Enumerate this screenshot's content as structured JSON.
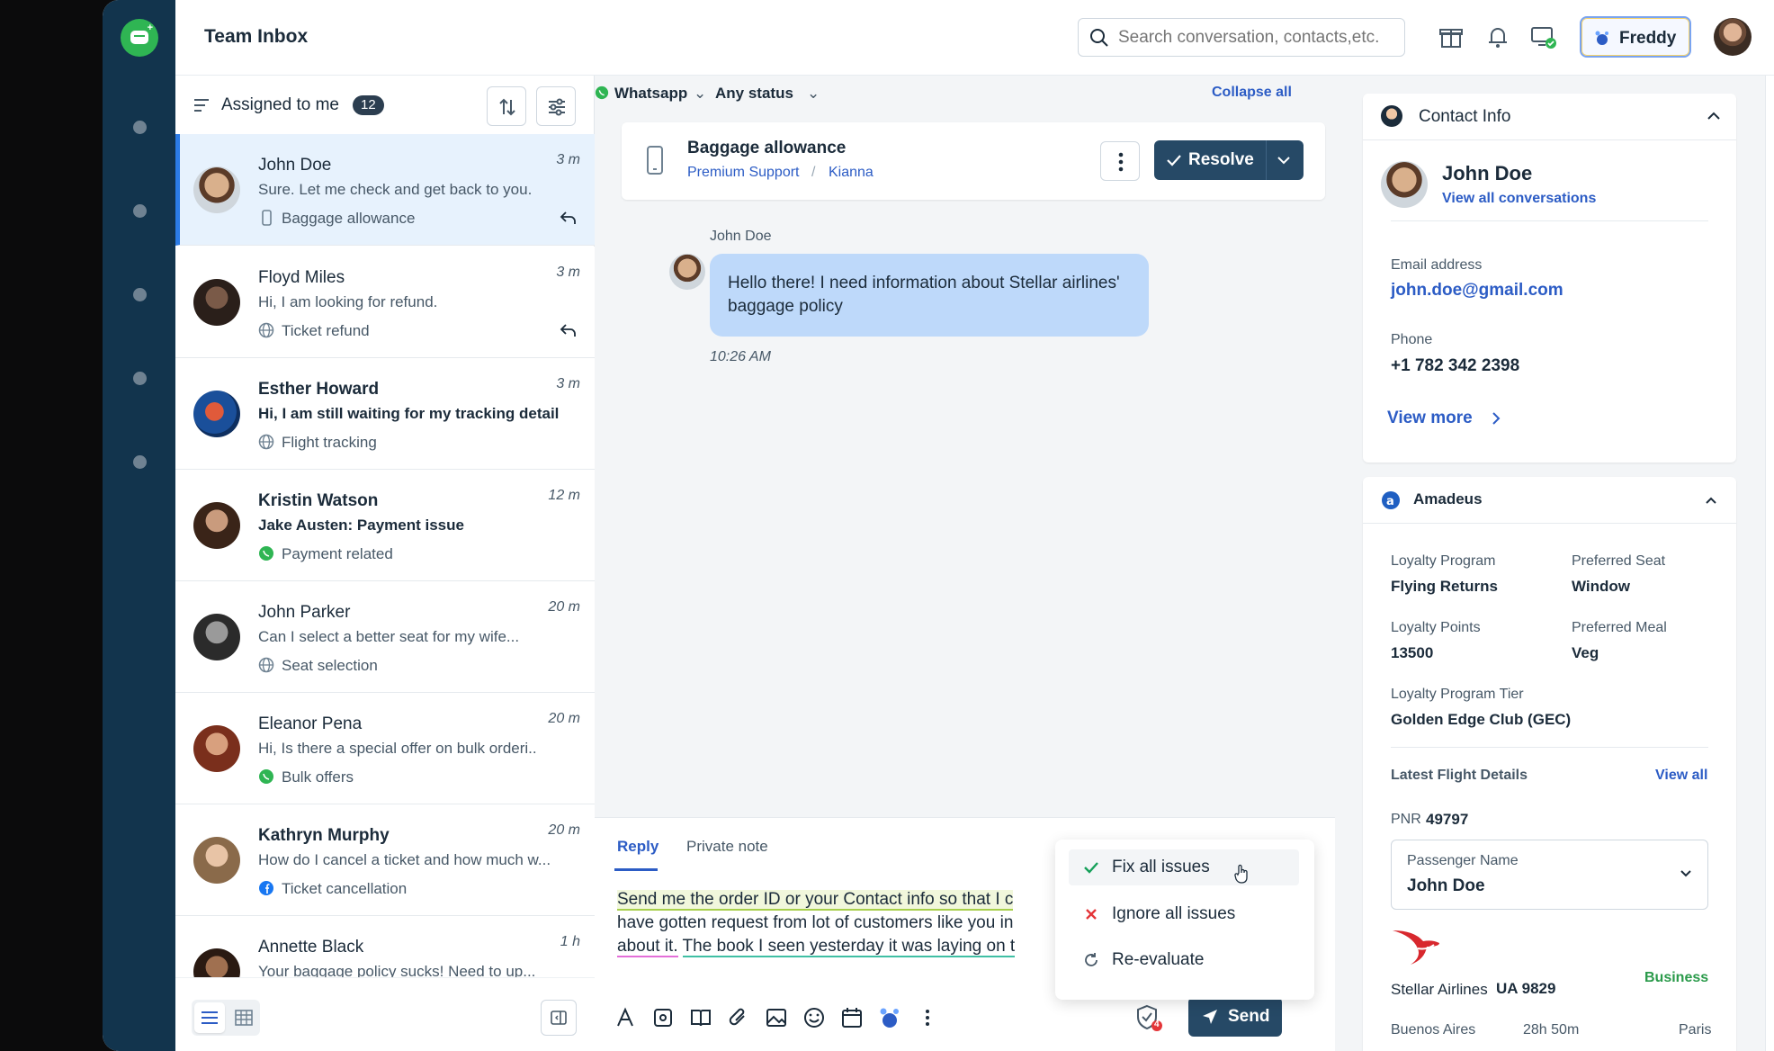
{
  "app": {
    "title": "Team Inbox"
  },
  "search": {
    "placeholder": "Search conversation, contacts,etc."
  },
  "header": {
    "freddy_label": "Freddy"
  },
  "list": {
    "filter_label": "Assigned to me",
    "count": "12",
    "items": [
      {
        "name": "John Doe",
        "time": "3 m",
        "preview": "Sure. Let me check and get back to you.",
        "tag": "Baggage allowance",
        "channel": "phone"
      },
      {
        "name": "Floyd Miles",
        "time": "3 m",
        "preview": "Hi, I am looking for refund.",
        "tag": "Ticket refund",
        "channel": "web"
      },
      {
        "name": "Esther Howard",
        "time": "3 m",
        "preview": "Hi, I am still waiting for my tracking details",
        "tag": "Flight tracking",
        "channel": "web"
      },
      {
        "name": "Kristin Watson",
        "time": "12 m",
        "preview": "Jake Austen: Payment issue",
        "tag": "Payment related",
        "channel": "whatsapp"
      },
      {
        "name": "John Parker",
        "time": "20 m",
        "preview": "Can I select a better seat for my wife...",
        "tag": "Seat selection",
        "channel": "web"
      },
      {
        "name": "Eleanor Pena",
        "time": "20 m",
        "preview": "Hi, Is there a special offer on bulk orderi..",
        "tag": "Bulk offers",
        "channel": "whatsapp"
      },
      {
        "name": "Kathryn Murphy",
        "time": "20 m",
        "preview": "How do I cancel a ticket and how much w...",
        "tag": "Ticket cancellation",
        "channel": "facebook"
      },
      {
        "name": "Annette Black",
        "time": "1 h",
        "preview": "Your baggage policy sucks! Need to up...",
        "tag": "",
        "channel": ""
      }
    ]
  },
  "conversation": {
    "channel_filter": "Whatsapp",
    "status_filter": "Any status",
    "collapse_label": "Collapse all",
    "title": "Baggage allowance",
    "group": "Premium Support",
    "separator": "/",
    "agent": "Kianna",
    "resolve_label": "Resolve",
    "message": {
      "sender": "John Doe",
      "text": "Hello there! I need information about Stellar airlines' baggage policy",
      "time": "10:26 AM"
    }
  },
  "composer": {
    "tab_reply": "Reply",
    "tab_note": "Private note",
    "line1": "Send me the order ID or your Contact info so that I c",
    "line2": "have gotten request from lot of customers like you in",
    "line3a": "about it.",
    "line3b": "The book I seen yesterday it was laying on t",
    "send_label": "Send",
    "issue_count": "4"
  },
  "popup": {
    "fix": "Fix all issues",
    "ignore": "Ignore all issues",
    "reevaluate": "Re-evaluate"
  },
  "contact": {
    "header": "Contact Info",
    "name": "John Doe",
    "view_all": "View all conversations",
    "email_label": "Email address",
    "email": "john.doe@gmail.com",
    "phone_label": "Phone",
    "phone": "+1 782 342 2398",
    "view_more": "View more"
  },
  "amadeus": {
    "header": "Amadeus",
    "loyalty_program_label": "Loyalty Program",
    "loyalty_program": "Flying Returns",
    "preferred_seat_label": "Preferred Seat",
    "preferred_seat": "Window",
    "loyalty_points_label": "Loyalty Points",
    "loyalty_points": "13500",
    "preferred_meal_label": "Preferred Meal",
    "preferred_meal": "Veg",
    "tier_label": "Loyalty Program Tier",
    "tier": "Golden Edge Club (GEC)",
    "latest_label": "Latest Flight Details",
    "view_all": "View all",
    "pnr_label": "PNR",
    "pnr": "49797",
    "passenger_label": "Passenger Name",
    "passenger": "John Doe",
    "airline": "Stellar Airlines",
    "flight": "UA 9829",
    "class": "Business",
    "origin": "Buenos Aires",
    "duration": "28h 50m",
    "destination": "Paris"
  },
  "colors": {
    "accent": "#2c5cc5",
    "brand": "#2fb553",
    "nav": "#12344d",
    "primary_button": "#264966"
  }
}
